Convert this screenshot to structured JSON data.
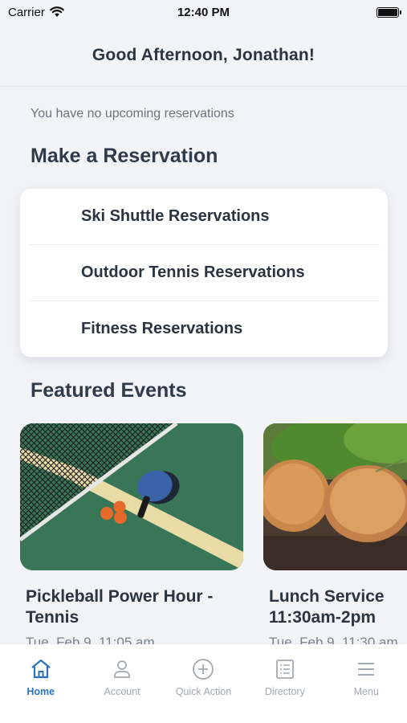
{
  "status_bar": {
    "carrier": "Carrier",
    "time": "12:40 PM"
  },
  "header": {
    "title": "Good Afternoon, Jonathan!"
  },
  "reservations": {
    "empty_message": "You have no upcoming reservations",
    "section_title": "Make a Reservation",
    "items": [
      {
        "label": "Ski Shuttle Reservations"
      },
      {
        "label": "Outdoor Tennis Reservations"
      },
      {
        "label": "Fitness Reservations"
      }
    ]
  },
  "featured": {
    "section_title": "Featured Events",
    "events": [
      {
        "title": "Pickleball Power Hour -\nTennis",
        "date": "Tue, Feb 9, 11:05 am"
      },
      {
        "title": "Lunch Service\n11:30am-2pm",
        "date": "Tue, Feb 9, 11:30 am"
      }
    ]
  },
  "tab_bar": {
    "tabs": [
      {
        "label": "Home",
        "icon": "home-icon",
        "active": true
      },
      {
        "label": "Account",
        "icon": "person-icon",
        "active": false
      },
      {
        "label": "Quick Action",
        "icon": "plus-circle-icon",
        "active": false
      },
      {
        "label": "Directory",
        "icon": "list-icon",
        "active": false
      },
      {
        "label": "Menu",
        "icon": "hamburger-icon",
        "active": false
      }
    ],
    "active_color": "#2a73c3",
    "inactive_color": "#a3a9b1"
  }
}
